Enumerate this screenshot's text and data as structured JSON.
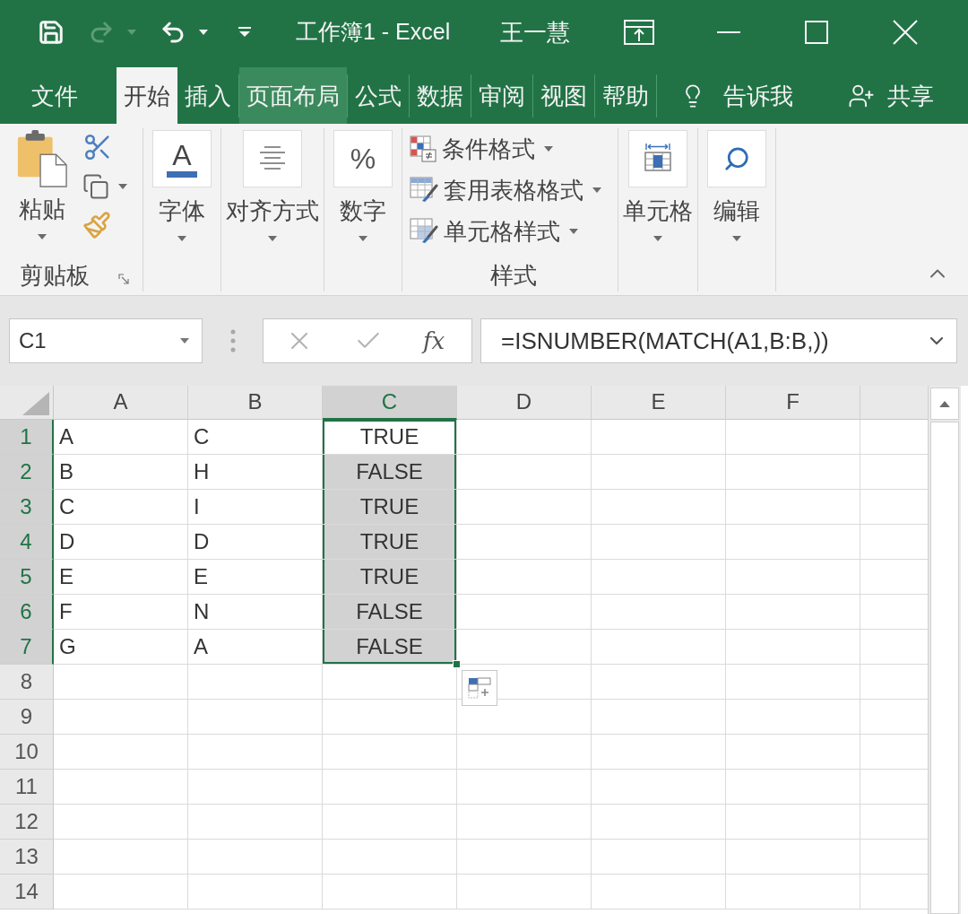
{
  "title_bar": {
    "title": "工作簿1 - Excel",
    "user": "王一慧"
  },
  "quick_access": [
    {
      "kind": "save",
      "disabled": false
    },
    {
      "kind": "redo",
      "disabled": true
    },
    {
      "kind": "undo",
      "disabled": false
    }
  ],
  "tabs": [
    {
      "label": "文件",
      "selected": false,
      "hovered": false
    },
    {
      "label": "开始",
      "selected": true,
      "hovered": false
    },
    {
      "label": "插入",
      "selected": false,
      "hovered": false
    },
    {
      "label": "页面布局",
      "selected": false,
      "hovered": true
    },
    {
      "label": "公式",
      "selected": false,
      "hovered": false
    },
    {
      "label": "数据",
      "selected": false,
      "hovered": false
    },
    {
      "label": "审阅",
      "selected": false,
      "hovered": false
    },
    {
      "label": "视图",
      "selected": false,
      "hovered": false
    },
    {
      "label": "帮助",
      "selected": false,
      "hovered": false
    }
  ],
  "tell_me": "告诉我",
  "share": "共享",
  "ribbon": {
    "groups": [
      {
        "kind": "clipboard",
        "paste": "粘贴",
        "label": "剪贴板"
      },
      {
        "kind": "font",
        "glyph": "A",
        "label": "字体"
      },
      {
        "kind": "alignment",
        "label": "对齐方式"
      },
      {
        "kind": "number",
        "glyph": "%",
        "label": "数字"
      },
      {
        "kind": "styles",
        "label": "样式",
        "items": [
          {
            "kind": "conditional",
            "label": "条件格式"
          },
          {
            "kind": "table",
            "label": "套用表格格式"
          },
          {
            "kind": "cellstyle",
            "label": "单元格样式"
          }
        ]
      },
      {
        "kind": "cells",
        "label": "单元格"
      },
      {
        "kind": "editing",
        "label": "编辑"
      }
    ]
  },
  "formula_bar": {
    "name_box": "C1",
    "edit_buttons": [
      {
        "kind": "cancel",
        "disabled": true
      },
      {
        "kind": "enter",
        "disabled": true
      }
    ],
    "function_glyph": "fx",
    "formula": "=ISNUMBER(MATCH(A1,B:B,))"
  },
  "sheet": {
    "columns": [
      {
        "label": "A",
        "selected": false
      },
      {
        "label": "B",
        "selected": false
      },
      {
        "label": "C",
        "selected": true
      },
      {
        "label": "D",
        "selected": false
      },
      {
        "label": "E",
        "selected": false
      },
      {
        "label": "F",
        "selected": false
      }
    ],
    "rows": [
      {
        "number": "1",
        "selected": true,
        "cells": [
          {
            "value": "A",
            "kind": "text",
            "selected": false,
            "active": false
          },
          {
            "value": "C",
            "kind": "text",
            "selected": false,
            "active": false
          },
          {
            "value": "TRUE",
            "kind": "logical",
            "selected": true,
            "active": true
          }
        ]
      },
      {
        "number": "2",
        "selected": true,
        "cells": [
          {
            "value": "B",
            "kind": "text",
            "selected": false,
            "active": false
          },
          {
            "value": "H",
            "kind": "text",
            "selected": false,
            "active": false
          },
          {
            "value": "FALSE",
            "kind": "logical",
            "selected": true,
            "active": false
          }
        ]
      },
      {
        "number": "3",
        "selected": true,
        "cells": [
          {
            "value": "C",
            "kind": "text",
            "selected": false,
            "active": false
          },
          {
            "value": "I",
            "kind": "text",
            "selected": false,
            "active": false
          },
          {
            "value": "TRUE",
            "kind": "logical",
            "selected": true,
            "active": false
          }
        ]
      },
      {
        "number": "4",
        "selected": true,
        "cells": [
          {
            "value": "D",
            "kind": "text",
            "selected": false,
            "active": false
          },
          {
            "value": "D",
            "kind": "text",
            "selected": false,
            "active": false
          },
          {
            "value": "TRUE",
            "kind": "logical",
            "selected": true,
            "active": false
          }
        ]
      },
      {
        "number": "5",
        "selected": true,
        "cells": [
          {
            "value": "E",
            "kind": "text",
            "selected": false,
            "active": false
          },
          {
            "value": "E",
            "kind": "text",
            "selected": false,
            "active": false
          },
          {
            "value": "TRUE",
            "kind": "logical",
            "selected": true,
            "active": false
          }
        ]
      },
      {
        "number": "6",
        "selected": true,
        "cells": [
          {
            "value": "F",
            "kind": "text",
            "selected": false,
            "active": false
          },
          {
            "value": "N",
            "kind": "text",
            "selected": false,
            "active": false
          },
          {
            "value": "FALSE",
            "kind": "logical",
            "selected": true,
            "active": false
          }
        ]
      },
      {
        "number": "7",
        "selected": true,
        "cells": [
          {
            "value": "G",
            "kind": "text",
            "selected": false,
            "active": false
          },
          {
            "value": "A",
            "kind": "text",
            "selected": false,
            "active": false
          },
          {
            "value": "FALSE",
            "kind": "logical",
            "selected": true,
            "active": false
          }
        ]
      },
      {
        "number": "8",
        "selected": false
      },
      {
        "number": "9",
        "selected": false
      },
      {
        "number": "10",
        "selected": false
      },
      {
        "number": "11",
        "selected": false
      },
      {
        "number": "12",
        "selected": false
      },
      {
        "number": "13",
        "selected": false
      },
      {
        "number": "14",
        "selected": false
      }
    ]
  }
}
